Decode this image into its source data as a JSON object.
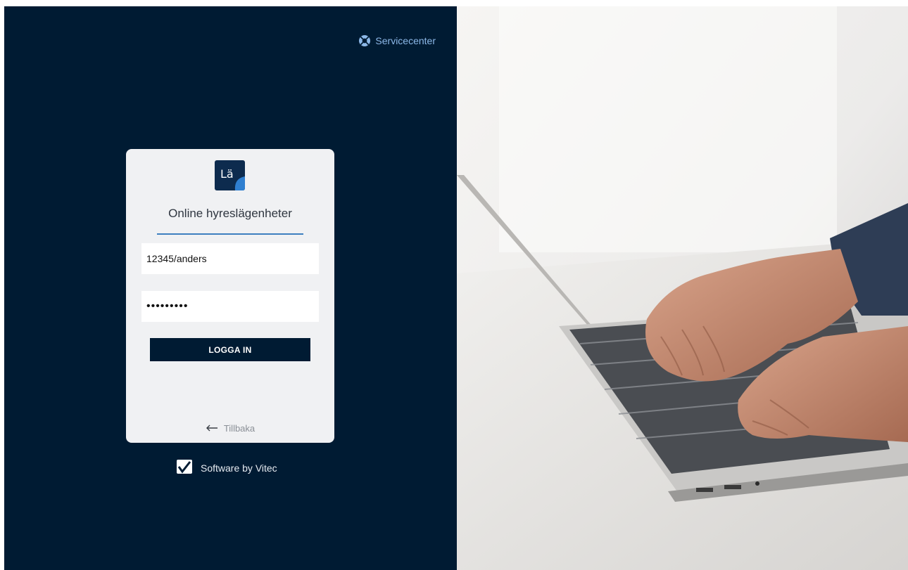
{
  "header": {
    "service_label": "Servicecenter",
    "service_icon": "lifebuoy-icon"
  },
  "login": {
    "logo_text": "Lä",
    "title": "Online hyreslägenheter",
    "username_value": "12345/anders",
    "password_value": "password1",
    "submit_label": "LOGGA IN",
    "back_label": "Tillbaka",
    "back_icon": "arrow-left-icon"
  },
  "footer": {
    "brand_label": "Software by Vitec",
    "brand_icon": "vitec-logo-icon"
  },
  "colors": {
    "panel_bg": "#001b33",
    "card_bg": "#f0f1f3",
    "accent": "#3d7fbf",
    "link": "#8db8e8"
  }
}
